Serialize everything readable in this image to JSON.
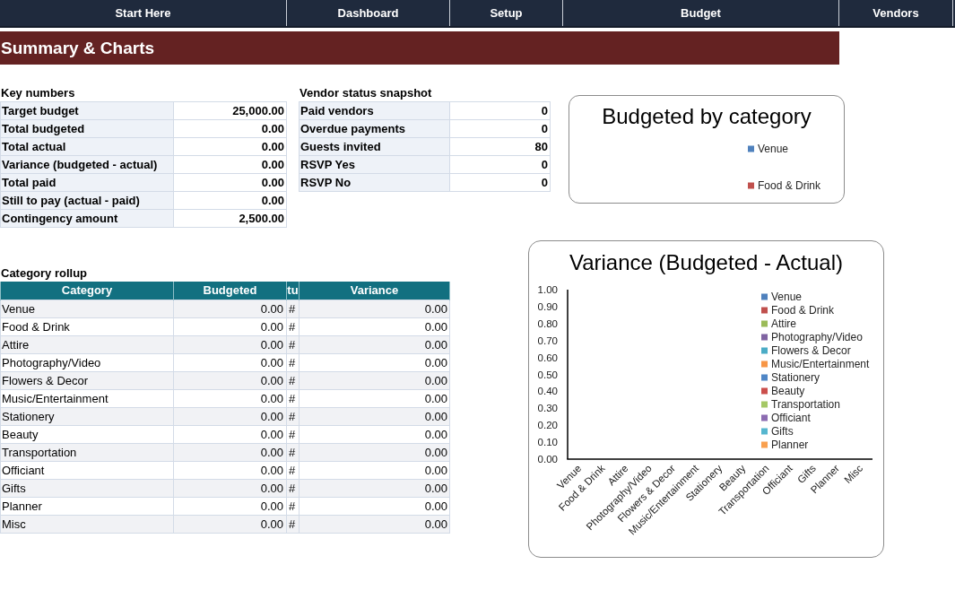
{
  "nav_tabs": [
    "Start Here",
    "Dashboard",
    "Setup",
    "Budget",
    "Vendors"
  ],
  "page_title": "Summary & Charts",
  "key_numbers": {
    "title": "Key numbers",
    "rows": [
      {
        "label": "Target budget",
        "value": "25,000.00"
      },
      {
        "label": "Total budgeted",
        "value": "0.00"
      },
      {
        "label": "Total actual",
        "value": "0.00"
      },
      {
        "label": "Variance (budgeted - actual)",
        "value": "0.00"
      },
      {
        "label": "Total paid",
        "value": "0.00"
      },
      {
        "label": "Still to pay (actual - paid)",
        "value": "0.00"
      },
      {
        "label": "Contingency amount",
        "value": "2,500.00"
      }
    ]
  },
  "vendor_status": {
    "title": "Vendor status snapshot",
    "rows": [
      {
        "label": "Paid vendors",
        "value": "0"
      },
      {
        "label": "Overdue payments",
        "value": "0"
      },
      {
        "label": "Guests invited",
        "value": "80"
      },
      {
        "label": "RSVP Yes",
        "value": "0"
      },
      {
        "label": "RSVP No",
        "value": "0"
      }
    ]
  },
  "budget_chart": {
    "title": "Budgeted by category",
    "legend": [
      {
        "label": "Venue",
        "color": "#4f81bd"
      },
      {
        "label": "Food & Drink",
        "color": "#c0504d"
      }
    ]
  },
  "category_rollup": {
    "title": "Category rollup",
    "columns": [
      "Category",
      "Budgeted",
      "tu",
      "Variance"
    ],
    "rows": [
      [
        "Venue",
        "0.00",
        "#",
        "0.00"
      ],
      [
        "Food & Drink",
        "0.00",
        "#",
        "0.00"
      ],
      [
        "Attire",
        "0.00",
        "#",
        "0.00"
      ],
      [
        "Photography/Video",
        "0.00",
        "#",
        "0.00"
      ],
      [
        "Flowers & Decor",
        "0.00",
        "#",
        "0.00"
      ],
      [
        "Music/Entertainment",
        "0.00",
        "#",
        "0.00"
      ],
      [
        "Stationery",
        "0.00",
        "#",
        "0.00"
      ],
      [
        "Beauty",
        "0.00",
        "#",
        "0.00"
      ],
      [
        "Transportation",
        "0.00",
        "#",
        "0.00"
      ],
      [
        "Officiant",
        "0.00",
        "#",
        "0.00"
      ],
      [
        "Gifts",
        "0.00",
        "#",
        "0.00"
      ],
      [
        "Planner",
        "0.00",
        "#",
        "0.00"
      ],
      [
        "Misc",
        "0.00",
        "#",
        "0.00"
      ]
    ]
  },
  "variance_chart": {
    "chart_data": {
      "type": "bar",
      "title": "Variance (Budgeted - Actual)",
      "categories": [
        "Venue",
        "Food & Drink",
        "Attire",
        "Photography/Video",
        "Flowers & Decor",
        "Music/Entertainment",
        "Stationery",
        "Beauty",
        "Transportation",
        "Officiant",
        "Gifts",
        "Planner",
        "Misc"
      ],
      "series": [
        {
          "name": "Venue",
          "color": "#4f81bd",
          "values": [
            0,
            0,
            0,
            0,
            0,
            0,
            0,
            0,
            0,
            0,
            0,
            0,
            0
          ]
        },
        {
          "name": "Food & Drink",
          "color": "#c0504d",
          "values": [
            0,
            0,
            0,
            0,
            0,
            0,
            0,
            0,
            0,
            0,
            0,
            0,
            0
          ]
        },
        {
          "name": "Attire",
          "color": "#9bbb59",
          "values": [
            0,
            0,
            0,
            0,
            0,
            0,
            0,
            0,
            0,
            0,
            0,
            0,
            0
          ]
        },
        {
          "name": "Photography/Video",
          "color": "#8064a2",
          "values": [
            0,
            0,
            0,
            0,
            0,
            0,
            0,
            0,
            0,
            0,
            0,
            0,
            0
          ]
        },
        {
          "name": "Flowers & Decor",
          "color": "#4bacc6",
          "values": [
            0,
            0,
            0,
            0,
            0,
            0,
            0,
            0,
            0,
            0,
            0,
            0,
            0
          ]
        },
        {
          "name": "Music/Entertainment",
          "color": "#f79646",
          "values": [
            0,
            0,
            0,
            0,
            0,
            0,
            0,
            0,
            0,
            0,
            0,
            0,
            0
          ]
        },
        {
          "name": "Stationery",
          "color": "#4f86c6",
          "values": [
            0,
            0,
            0,
            0,
            0,
            0,
            0,
            0,
            0,
            0,
            0,
            0,
            0
          ]
        },
        {
          "name": "Beauty",
          "color": "#cb4f4c",
          "values": [
            0,
            0,
            0,
            0,
            0,
            0,
            0,
            0,
            0,
            0,
            0,
            0,
            0
          ]
        },
        {
          "name": "Transportation",
          "color": "#a5c866",
          "values": [
            0,
            0,
            0,
            0,
            0,
            0,
            0,
            0,
            0,
            0,
            0,
            0,
            0
          ]
        },
        {
          "name": "Officiant",
          "color": "#8c6bb1",
          "values": [
            0,
            0,
            0,
            0,
            0,
            0,
            0,
            0,
            0,
            0,
            0,
            0,
            0
          ]
        },
        {
          "name": "Gifts",
          "color": "#56b6cf",
          "values": [
            0,
            0,
            0,
            0,
            0,
            0,
            0,
            0,
            0,
            0,
            0,
            0,
            0
          ]
        },
        {
          "name": "Planner",
          "color": "#f9a04f",
          "values": [
            0,
            0,
            0,
            0,
            0,
            0,
            0,
            0,
            0,
            0,
            0,
            0,
            0
          ]
        }
      ],
      "ylim": [
        0,
        1
      ],
      "yticks": [
        {
          "value": 0,
          "label": "0.00"
        },
        {
          "value": 0.1,
          "label": "0.10"
        },
        {
          "value": 0.2,
          "label": "0.20"
        },
        {
          "value": 0.3,
          "label": "0.30"
        },
        {
          "value": 0.4,
          "label": "0.40"
        },
        {
          "value": 0.5,
          "label": "0.50"
        },
        {
          "value": 0.6,
          "label": "0.60"
        },
        {
          "value": 0.7,
          "label": "0.70"
        },
        {
          "value": 0.8,
          "label": "0.80"
        },
        {
          "value": 0.9,
          "label": "0.90"
        },
        {
          "value": 1,
          "label": "1.00"
        }
      ]
    }
  }
}
